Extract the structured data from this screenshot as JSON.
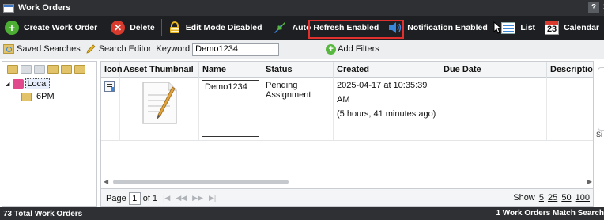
{
  "window": {
    "title": "Work Orders",
    "help_label": "?",
    "close_label": "x"
  },
  "toolbar": {
    "create_label": "Create Work Order",
    "delete_label": "Delete",
    "edit_mode_label": "Edit Mode Disabled",
    "auto_refresh_label": "Auto Refresh Enabled",
    "notification_label": "Notification Enabled",
    "list_label": "List",
    "calendar_label": "Calendar",
    "calendar_day": "23"
  },
  "search": {
    "saved_searches_label": "Saved Searches",
    "search_editor_label": "Search Editor",
    "keyword_label": "Keyword",
    "keyword_value": "Demo1234",
    "add_filters_label": "Add Filters"
  },
  "tree": {
    "root_label": "Local",
    "child_label": "6PM"
  },
  "grid": {
    "columns": [
      "Icon",
      "Asset Thumbnail",
      "Name",
      "Status",
      "Created",
      "Due Date",
      "Description"
    ],
    "rows": [
      {
        "name": "Demo1234",
        "status": "Pending Assignment",
        "created": "2025-04-17 at 10:35:39 AM",
        "created_relative": "(5 hours, 41 minutes ago)",
        "due_date": "",
        "description": ""
      }
    ]
  },
  "pager": {
    "page_label": "Page",
    "page_value": "1",
    "of_label": "of 1",
    "show_label": "Show",
    "show_options": [
      "5",
      "25",
      "50",
      "100"
    ]
  },
  "footer": {
    "total_label": "73 Total Work Orders",
    "match_label": "1 Work Orders Match Search"
  },
  "side_label": "Si",
  "colors": {
    "toolbar_bg": "#1d1f22",
    "titlebar_bg": "#2e3033",
    "highlight": "#e0312f"
  }
}
